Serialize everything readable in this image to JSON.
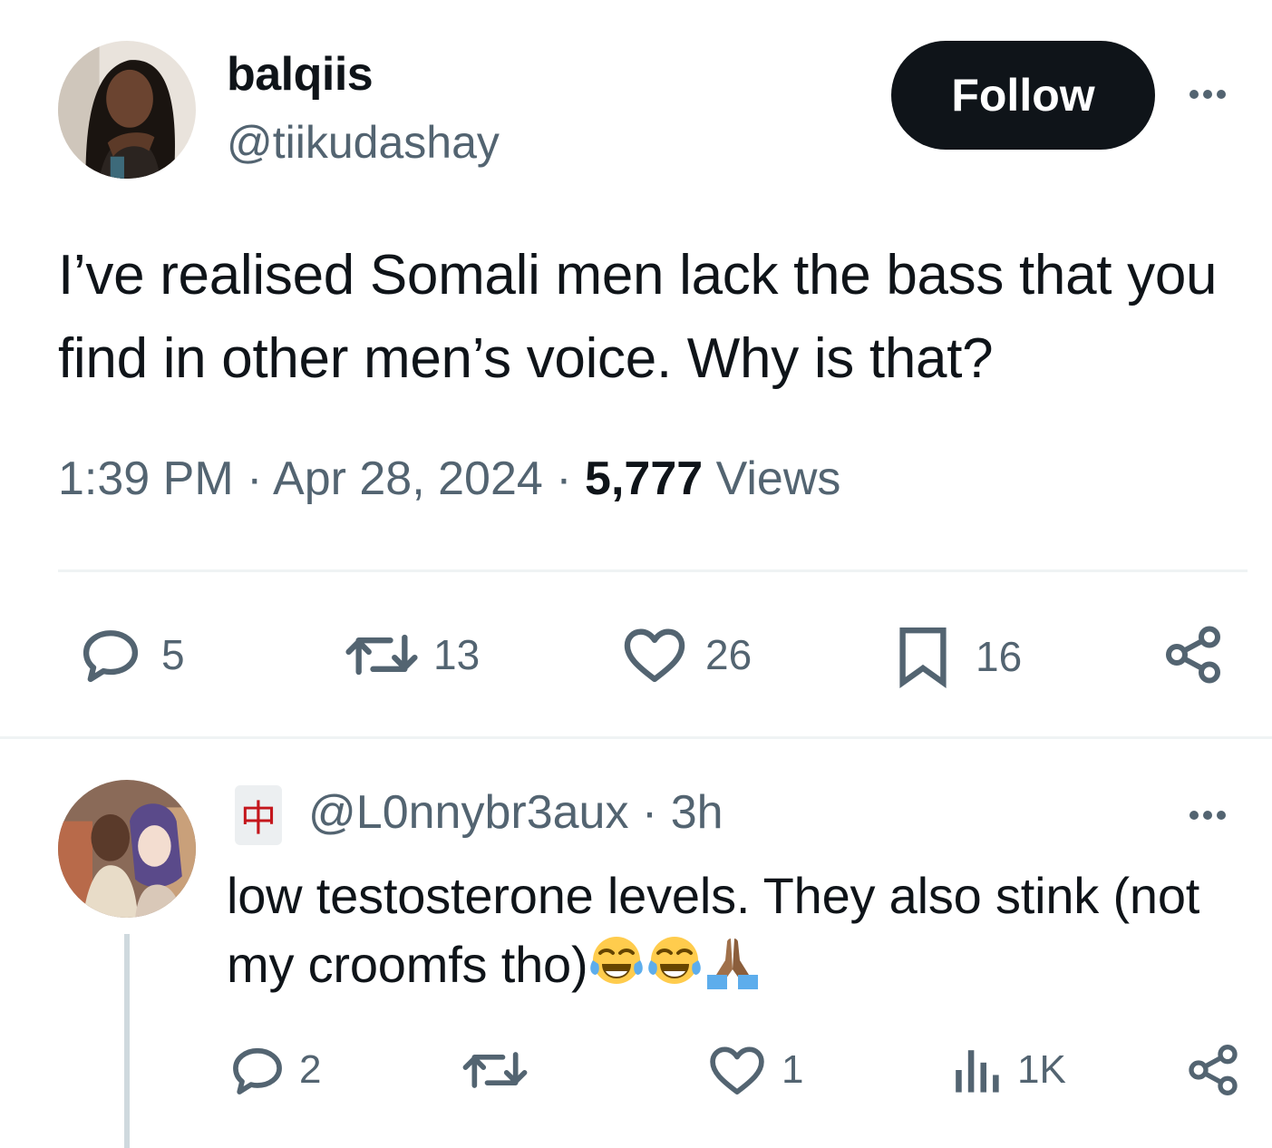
{
  "tweet": {
    "author": {
      "display_name": "balqiis",
      "handle": "@tiikudashay",
      "avatar": "profile-photo"
    },
    "follow_label": "Follow",
    "text": "I’ve realised Somali men lack the bass that you find in other men’s voice. Why is that?",
    "time": "1:39 PM",
    "separator": "·",
    "date": "Apr 28, 2024",
    "views_count": "5,777",
    "views_label": "Views",
    "stats": {
      "replies": "5",
      "retweets": "13",
      "likes": "26",
      "bookmarks": "16"
    }
  },
  "reply": {
    "badge": "中",
    "handle": "@L0nnybr3aux",
    "time": "3h",
    "text": "low testosterone levels. They also stink (not my croomfs tho)",
    "emojis": [
      "face-with-tears-of-joy",
      "face-with-tears-of-joy",
      "folded-hands"
    ],
    "stats": {
      "replies": "2",
      "retweets": "",
      "likes": "1",
      "views": "1K"
    }
  },
  "colors": {
    "text": "#0f1419",
    "secondary": "#536471",
    "divider": "#eff3f4",
    "button": "#0f1419"
  }
}
